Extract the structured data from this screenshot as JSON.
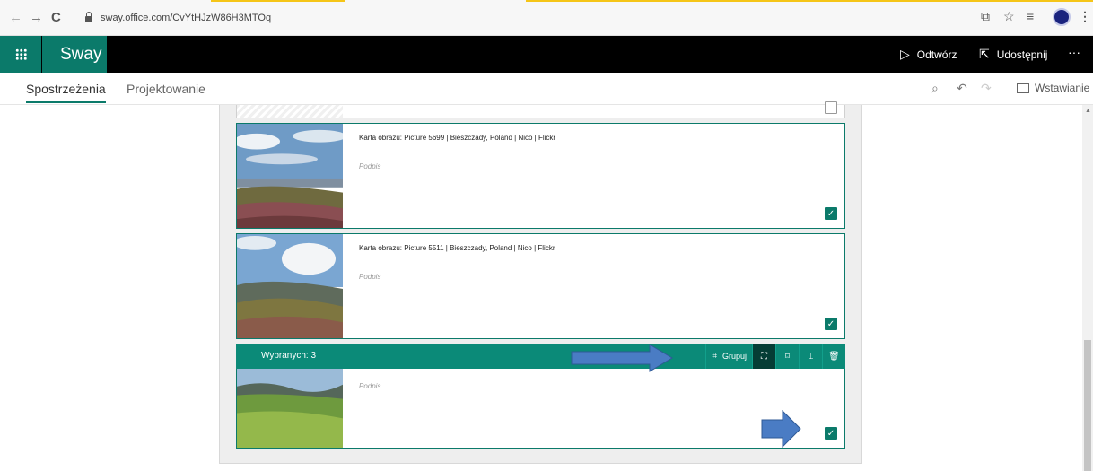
{
  "browser": {
    "back_icon": "←",
    "forward_icon": "→",
    "reload_icon": "C",
    "url": "sway.office.com/CvYtHJzW86H3MTOq"
  },
  "app": {
    "name": "Sway",
    "play_label": "Odtwórz",
    "share_label": "Udostępnij",
    "more_icon": "···"
  },
  "subnav": {
    "tabs": [
      "Spostrzeżenia",
      "Projektowanie"
    ],
    "insert_label": "Wstawianie"
  },
  "cards": [
    {
      "title": "Karta obrazu: Picture 5699 | Bieszczady, Poland | Nico | Flickr",
      "caption": "Podpis",
      "checked": true
    },
    {
      "title": "Karta obrazu: Picture 5511 | Bieszczady, Poland | Nico | Flickr",
      "caption": "Podpis",
      "checked": true
    },
    {
      "title": "",
      "caption": "Podpis",
      "checked": true
    }
  ],
  "selection": {
    "count_label": "Wybranych: 3",
    "group_label": "Grupuj"
  },
  "colors": {
    "accent": "#0b7a6a",
    "arrow": "#4a7cc4"
  }
}
